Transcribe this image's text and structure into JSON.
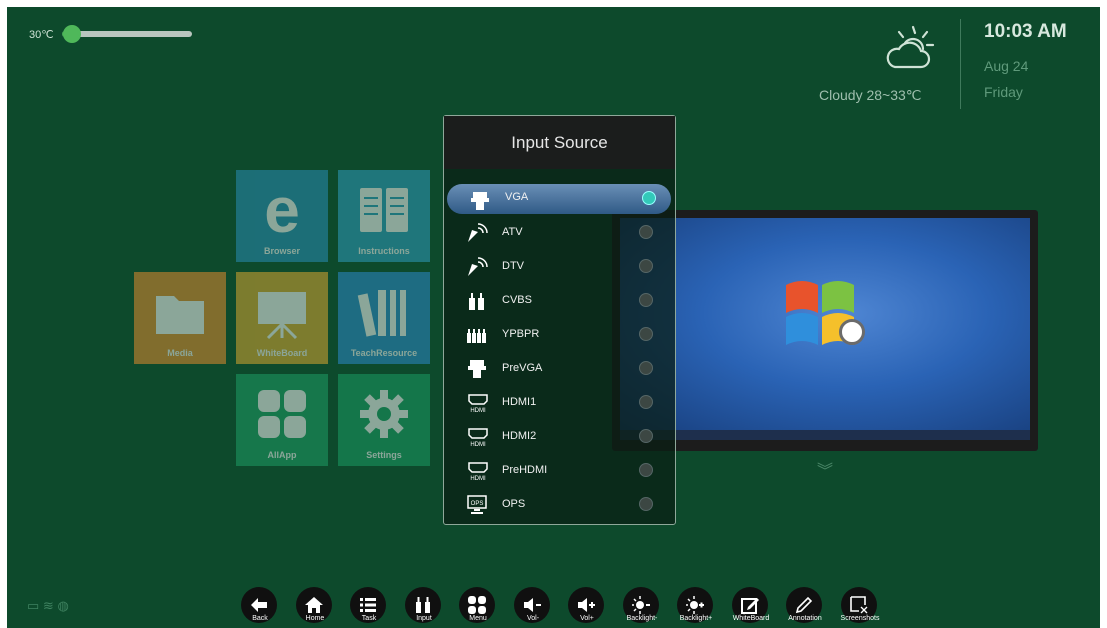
{
  "status": {
    "temperature": "30℃",
    "temperature_level": 0.08
  },
  "weather": {
    "condition_text": "Cloudy  28~33℃",
    "time": "10:03 AM",
    "date": "Aug 24",
    "day": "Friday"
  },
  "apps": [
    {
      "label": "Browser",
      "color": "#2a8db5",
      "icon": "browser-icon"
    },
    {
      "label": "Instructions",
      "color": "#2f9bbd",
      "icon": "book-icon"
    },
    {
      "label": "Media",
      "color": "#e08a2e",
      "icon": "folder-icon"
    },
    {
      "label": "WhiteBoard",
      "color": "#d9a531",
      "icon": "easel-icon"
    },
    {
      "label": "TeachResource",
      "color": "#2d88c9",
      "icon": "books-icon"
    },
    {
      "label": "AllApp",
      "color": "#1f9c66",
      "icon": "grid-icon"
    },
    {
      "label": "Settings",
      "color": "#1b9a64",
      "icon": "gear-icon"
    }
  ],
  "dialog": {
    "title": "Input Source",
    "selected": "VGA",
    "sources": [
      {
        "name": "VGA",
        "icon": "vga-icon"
      },
      {
        "name": "ATV",
        "icon": "satellite-icon"
      },
      {
        "name": "DTV",
        "icon": "satellite-icon"
      },
      {
        "name": "CVBS",
        "icon": "rca-icon"
      },
      {
        "name": "YPBPR",
        "icon": "component-icon"
      },
      {
        "name": "PreVGA",
        "icon": "vga-icon"
      },
      {
        "name": "HDMI1",
        "icon": "hdmi-icon"
      },
      {
        "name": "HDMI2",
        "icon": "hdmi-icon"
      },
      {
        "name": "PreHDMI",
        "icon": "hdmi-icon"
      },
      {
        "name": "OPS",
        "icon": "ops-icon"
      }
    ],
    "hdmi_badge": "HDMI",
    "ops_badge": "OPS"
  },
  "toolbar": [
    {
      "label": "Back",
      "icon": "back-arrow-icon"
    },
    {
      "label": "Home",
      "icon": "home-icon"
    },
    {
      "label": "Task",
      "icon": "task-list-icon"
    },
    {
      "label": "Input",
      "icon": "input-plug-icon"
    },
    {
      "label": "Menu",
      "icon": "menu-grid-icon"
    },
    {
      "label": "Vol-",
      "icon": "volume-down-icon"
    },
    {
      "label": "Vol+",
      "icon": "volume-up-icon"
    },
    {
      "label": "Backlight-",
      "icon": "backlight-down-icon"
    },
    {
      "label": "Backlight+",
      "icon": "backlight-up-icon"
    },
    {
      "label": "WhiteBoard",
      "icon": "whiteboard-edit-icon"
    },
    {
      "label": "Annotation",
      "icon": "pen-icon"
    },
    {
      "label": "Screenshots",
      "icon": "screenshot-icon"
    }
  ],
  "colors": {
    "background": "#0d4a2c",
    "accent": "#33c9b9",
    "selected_row": "#4f76a0"
  }
}
